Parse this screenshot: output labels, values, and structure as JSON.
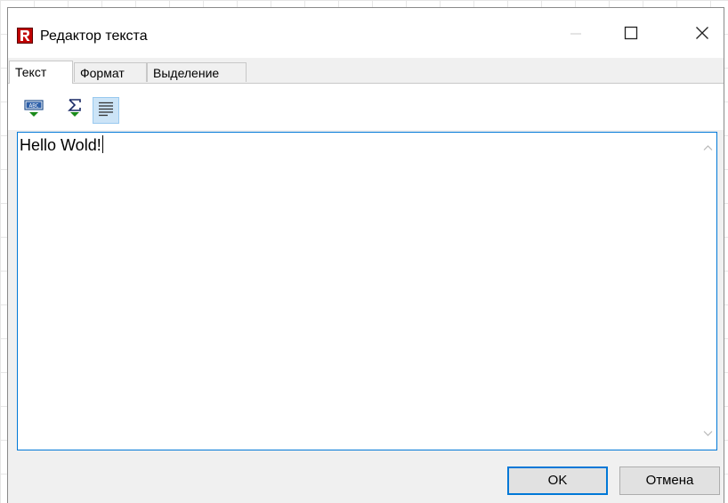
{
  "window": {
    "title": "Редактор текста",
    "controls": {
      "minimize_icon": "minimize-icon",
      "maximize_icon": "maximize-icon",
      "close_icon": "close-icon"
    }
  },
  "tabs": [
    {
      "label": "Текст",
      "active": true
    },
    {
      "label": "Формат",
      "active": false
    },
    {
      "label": "Выделение",
      "active": false
    }
  ],
  "toolbar": {
    "items": [
      {
        "icon": "insert-field-icon"
      },
      {
        "icon": "insert-aggregate-icon"
      },
      {
        "icon": "word-wrap-icon",
        "pressed": true
      }
    ]
  },
  "editor": {
    "text": "Hello Wold!"
  },
  "buttons": {
    "ok_label": "OK",
    "cancel_label": "Отмена"
  },
  "colors": {
    "accent": "#0078d7",
    "brand_red": "#c00000",
    "dialog_bg": "#f0f0f0",
    "pressed_bg": "#cce4f7",
    "icon_green": "#1a8a1a"
  }
}
